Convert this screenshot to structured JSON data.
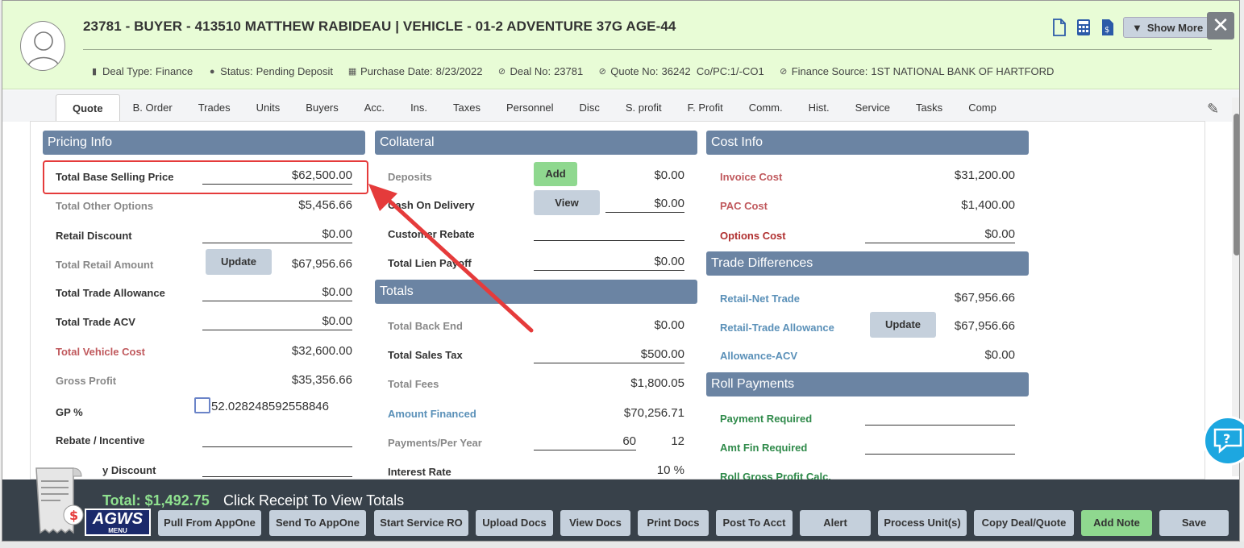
{
  "header": {
    "title": "23781 - BUYER - 413510 MATTHEW RABIDEAU | VEHICLE - 01-2 ADVENTURE 37G AGE-44",
    "meta": [
      {
        "key": "Deal Type:",
        "value": "Finance",
        "icon": "document-icon"
      },
      {
        "key": "Status:",
        "value": "Pending Deposit",
        "icon": "info-icon"
      },
      {
        "key": "Purchase Date:",
        "value": "8/23/2022",
        "icon": "calendar-icon"
      },
      {
        "key": "Deal No:",
        "value": "23781",
        "icon": "check-circle-icon"
      },
      {
        "key": "Quote No:",
        "value": "36242  Co/PC:1/-CO1",
        "icon": "check-circle-icon"
      },
      {
        "key": "Finance Source:",
        "value": "1ST NATIONAL BANK OF HARTFORD",
        "icon": "check-circle-icon"
      }
    ],
    "show_more": "Show More"
  },
  "tabs": [
    "Quote",
    "B. Order",
    "Trades",
    "Units",
    "Buyers",
    "Acc.",
    "Ins.",
    "Taxes",
    "Personnel",
    "Disc",
    "S. profit",
    "F. Profit",
    "Comm.",
    "Hist.",
    "Service",
    "Tasks",
    "Comp"
  ],
  "pricing": {
    "title": "Pricing Info",
    "rows": [
      {
        "label": "Total Base Selling Price",
        "value": "$62,500.00"
      },
      {
        "label": "Total Other Options",
        "value": "$5,456.66"
      },
      {
        "label": "Retail Discount",
        "value": "$0.00"
      },
      {
        "label": "Total Retail Amount",
        "value": "$67,956.66",
        "button": "Update"
      },
      {
        "label": "Total Trade Allowance",
        "value": "$0.00"
      },
      {
        "label": "Total Trade ACV",
        "value": "$0.00"
      },
      {
        "label": "Total Vehicle Cost",
        "value": "$32,600.00"
      },
      {
        "label": "Gross Profit",
        "value": "$35,356.66"
      },
      {
        "label": "GP %",
        "value": "52.028248592558846"
      },
      {
        "label": "Rebate / Incentive",
        "value": ""
      },
      {
        "label": "y Discount",
        "value": ""
      }
    ]
  },
  "collateral": {
    "title": "Collateral",
    "rows": [
      {
        "label": "Deposits",
        "value": "$0.00",
        "button": "Add"
      },
      {
        "label": "Cash On Delivery",
        "value": "$0.00",
        "button": "View"
      },
      {
        "label": "Customer Rebate",
        "value": ""
      },
      {
        "label": "Total Lien Payoff",
        "value": "$0.00"
      }
    ]
  },
  "totals": {
    "title": "Totals",
    "rows": [
      {
        "label": "Total Back End",
        "value": "$0.00"
      },
      {
        "label": "Total Sales Tax",
        "value": "$500.00"
      },
      {
        "label": "Total Fees",
        "value": "$1,800.05"
      },
      {
        "label": "Amount Financed",
        "value": "$70,256.71"
      },
      {
        "label": "Payments/Per Year",
        "value": "60",
        "value2": "12"
      },
      {
        "label": "Interest Rate",
        "value": "10 %"
      }
    ]
  },
  "cost": {
    "title": "Cost Info",
    "rows": [
      {
        "label": "Invoice Cost",
        "value": "$31,200.00"
      },
      {
        "label": "PAC Cost",
        "value": "$1,400.00"
      },
      {
        "label": "Options Cost",
        "value": "$0.00"
      }
    ]
  },
  "trade_diff": {
    "title": "Trade Differences",
    "rows": [
      {
        "label": "Retail-Net Trade",
        "value": "$67,956.66"
      },
      {
        "label": "Retail-Trade Allowance",
        "value": "$67,956.66",
        "button": "Update"
      },
      {
        "label": "Allowance-ACV",
        "value": "$0.00"
      }
    ]
  },
  "roll": {
    "title": "Roll Payments",
    "rows": [
      {
        "label": "Payment Required",
        "value": ""
      },
      {
        "label": "Amt Fin Required",
        "value": ""
      },
      {
        "label": "Roll Gross Profit Calc.",
        "value": ""
      }
    ]
  },
  "footer": {
    "total": "Total: $1,492.75",
    "hint": "Click Receipt To View Totals",
    "logo_text": "AGWS",
    "logo_sub": "MENU",
    "buttons": [
      "Pull From AppOne",
      "Send To AppOne",
      "Start Service RO",
      "Upload Docs",
      "View Docs",
      "Print Docs",
      "Post To Acct",
      "Alert",
      "Process Unit(s)",
      "Copy Deal/Quote",
      "Add Note",
      "Save"
    ]
  },
  "colors": {
    "header_bg": "#e8fcd6",
    "panel_header": "#6b84a3",
    "highlight": "#e53b3b",
    "footer_bg": "#38414a",
    "total_green": "#8fe08f"
  }
}
